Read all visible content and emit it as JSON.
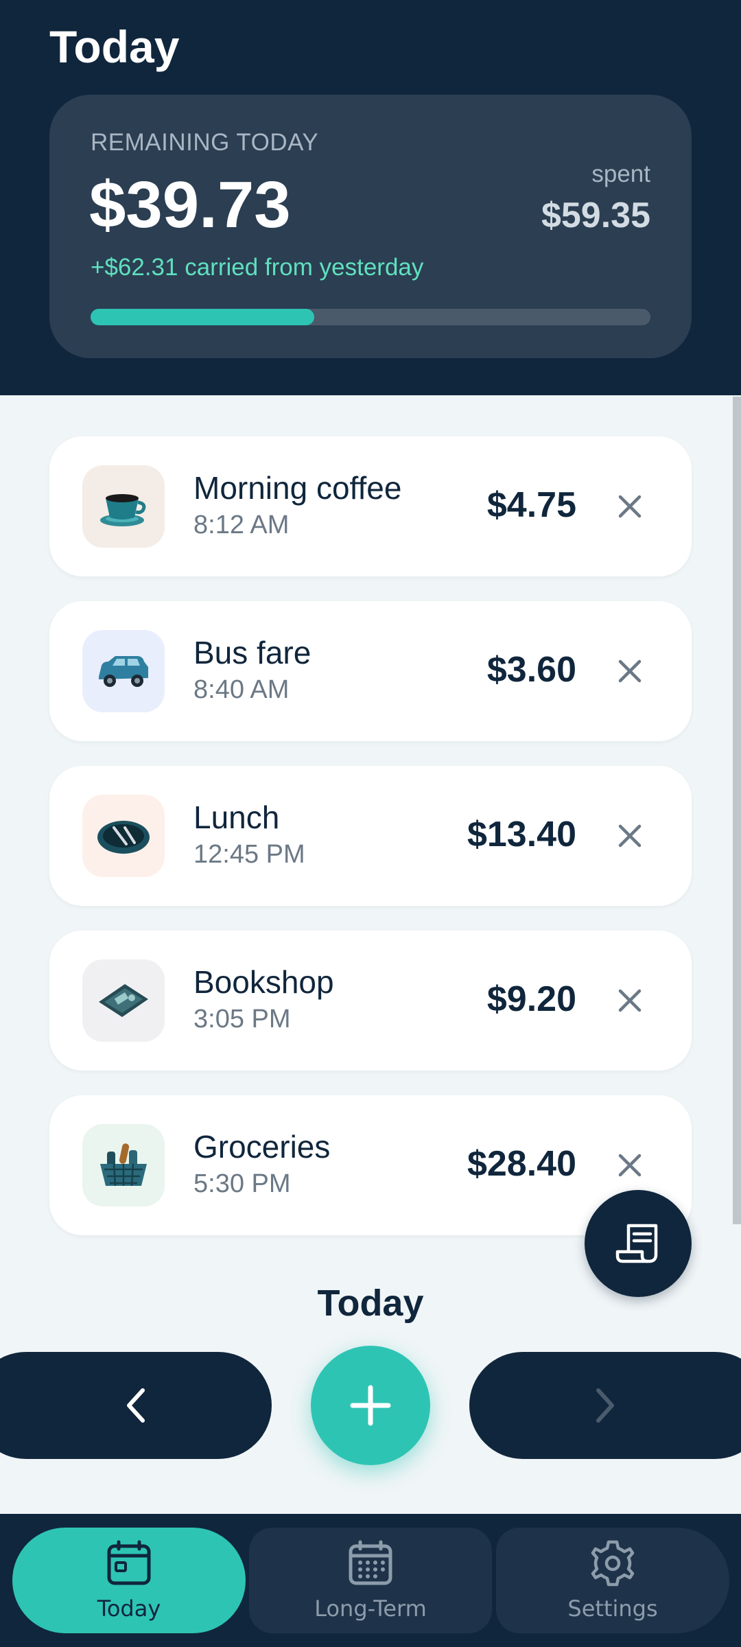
{
  "header": {
    "title": "Today"
  },
  "budget": {
    "remaining_label": "REMAINING TODAY",
    "remaining_amount": "$39.73",
    "spent_label": "spent",
    "spent_amount": "$59.35",
    "carry_text": "+$62.31 carried from yesterday",
    "progress_fraction": 0.4
  },
  "expenses": [
    {
      "name": "Morning coffee",
      "time": "8:12 AM",
      "amount": "$4.75",
      "icon": "coffee-cup-icon",
      "icon_bg": "#f4ece6"
    },
    {
      "name": "Bus fare",
      "time": "8:40 AM",
      "amount": "$3.60",
      "icon": "car-icon",
      "icon_bg": "#e8eefc"
    },
    {
      "name": "Lunch",
      "time": "12:45 PM",
      "amount": "$13.40",
      "icon": "plate-cutlery-icon",
      "icon_bg": "#fdf0ea"
    },
    {
      "name": "Bookshop",
      "time": "3:05 PM",
      "amount": "$9.20",
      "icon": "wallet-icon",
      "icon_bg": "#f0f0f2"
    },
    {
      "name": "Groceries",
      "time": "5:30 PM",
      "amount": "$28.40",
      "icon": "grocery-basket-icon",
      "icon_bg": "#e9f5ee"
    }
  ],
  "day_nav": {
    "label": "Today",
    "prev_icon": "chevron-left-icon",
    "next_icon": "chevron-right-icon",
    "add_icon": "plus-icon"
  },
  "fab": {
    "icon": "receipt-icon"
  },
  "bottom_nav": {
    "tabs": [
      {
        "label": "Today",
        "icon": "calendar-today-icon",
        "active": true
      },
      {
        "label": "Long-Term",
        "icon": "calendar-grid-icon",
        "active": false
      },
      {
        "label": "Settings",
        "icon": "gear-icon",
        "active": false
      }
    ]
  },
  "colors": {
    "header_bg": "#10263c",
    "accent": "#2ec4b4",
    "carry_green": "#5fe0be",
    "page_bg": "#f0f5f7"
  }
}
